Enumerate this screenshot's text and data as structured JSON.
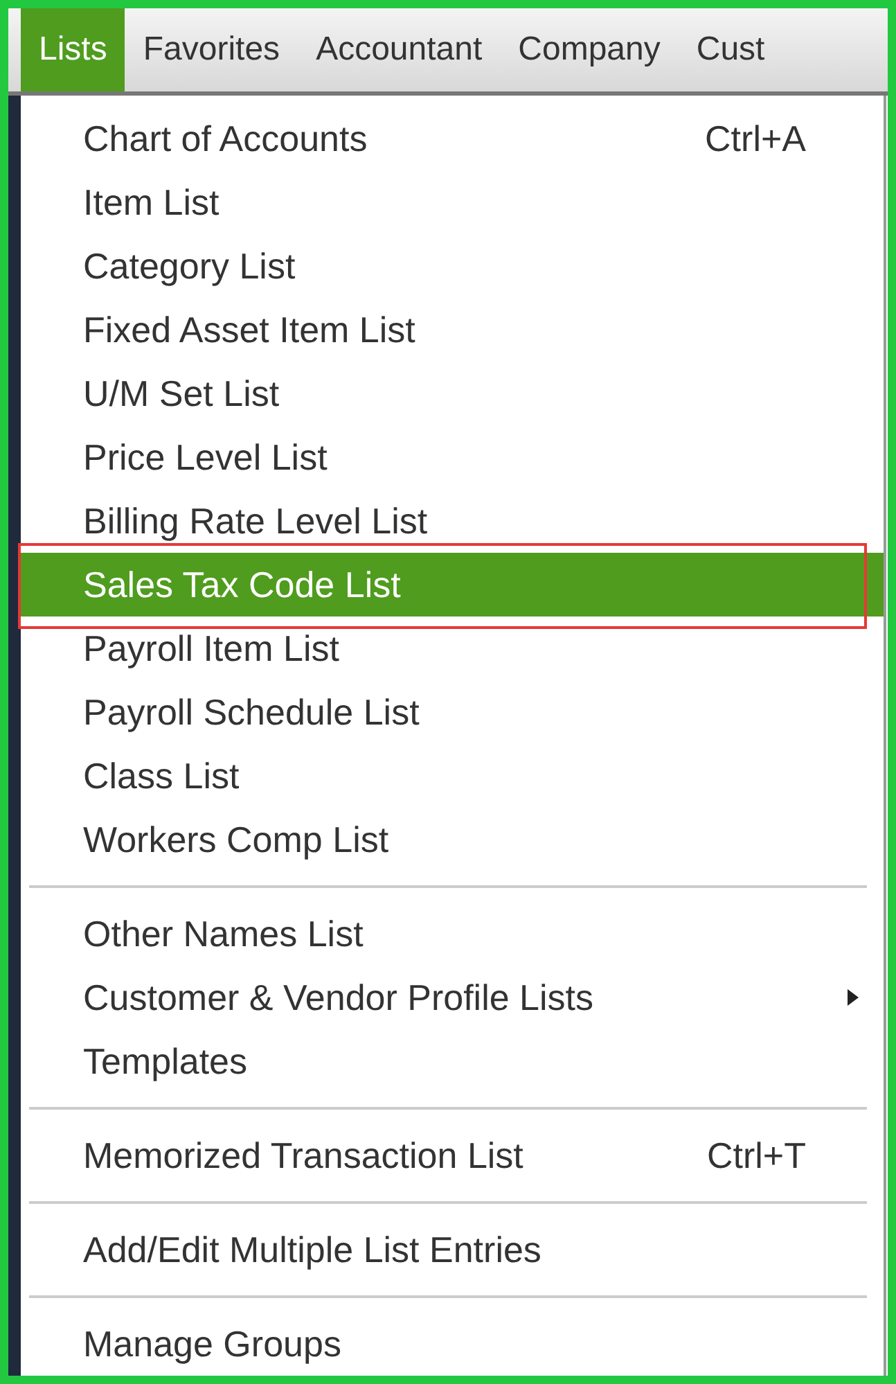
{
  "menu_bar": [
    {
      "label": "Lists",
      "selected": true
    },
    {
      "label": "Favorites",
      "selected": false
    },
    {
      "label": "Accountant",
      "selected": false
    },
    {
      "label": "Company",
      "selected": false
    },
    {
      "label": "Cust",
      "selected": false
    }
  ],
  "menu": {
    "groups": [
      [
        {
          "label": "Chart of Accounts",
          "shortcut": "Ctrl+A",
          "selected": false
        },
        {
          "label": "Item List",
          "selected": false
        },
        {
          "label": "Category List",
          "selected": false
        },
        {
          "label": "Fixed Asset Item List",
          "selected": false
        },
        {
          "label": "U/M Set List",
          "selected": false
        },
        {
          "label": "Price Level List",
          "selected": false
        },
        {
          "label": "Billing Rate Level List",
          "selected": false
        },
        {
          "label": "Sales Tax Code List",
          "selected": true
        },
        {
          "label": "Payroll Item List",
          "selected": false
        },
        {
          "label": "Payroll Schedule List",
          "selected": false
        },
        {
          "label": "Class List",
          "selected": false
        },
        {
          "label": "Workers Comp List",
          "selected": false
        }
      ],
      [
        {
          "label": "Other Names List",
          "selected": false
        },
        {
          "label": "Customer & Vendor Profile Lists",
          "submenu": true,
          "selected": false
        },
        {
          "label": "Templates",
          "selected": false
        }
      ],
      [
        {
          "label": "Memorized Transaction List",
          "shortcut": "Ctrl+T",
          "selected": false
        }
      ],
      [
        {
          "label": "Add/Edit Multiple List Entries",
          "selected": false
        }
      ],
      [
        {
          "label": "Manage Groups",
          "selected": false
        }
      ]
    ]
  }
}
